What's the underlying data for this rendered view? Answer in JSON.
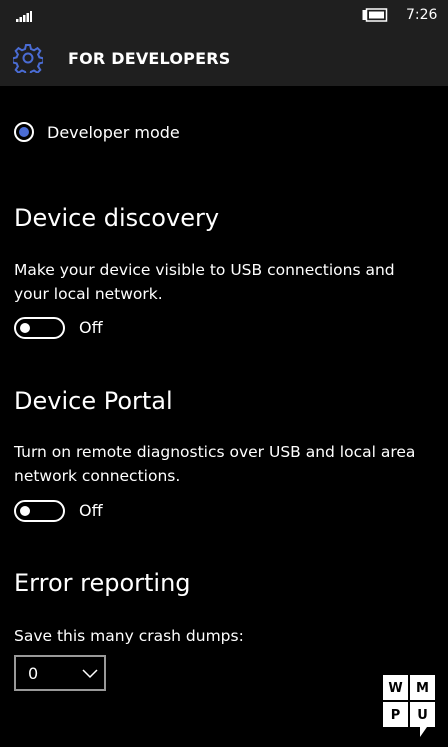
{
  "status": {
    "time": "7:26"
  },
  "appbar": {
    "title": "FOR DEVELOPERS"
  },
  "developer_mode": {
    "label": "Developer mode",
    "selected": true
  },
  "device_discovery": {
    "heading": "Device discovery",
    "description": "Make your device visible to USB connections and your local network.",
    "toggle_state": "Off"
  },
  "device_portal": {
    "heading": "Device Portal",
    "description": "Turn on remote diagnostics over USB and local area network connections.",
    "toggle_state": "Off"
  },
  "error_reporting": {
    "heading": "Error reporting",
    "label": "Save this many crash dumps:",
    "selected_value": "0"
  },
  "watermark": {
    "letters": [
      "W",
      "M",
      "P",
      "U"
    ]
  },
  "colors": {
    "accent": "#4a6cd4",
    "background": "#000000",
    "bar": "#1f1f1f"
  }
}
